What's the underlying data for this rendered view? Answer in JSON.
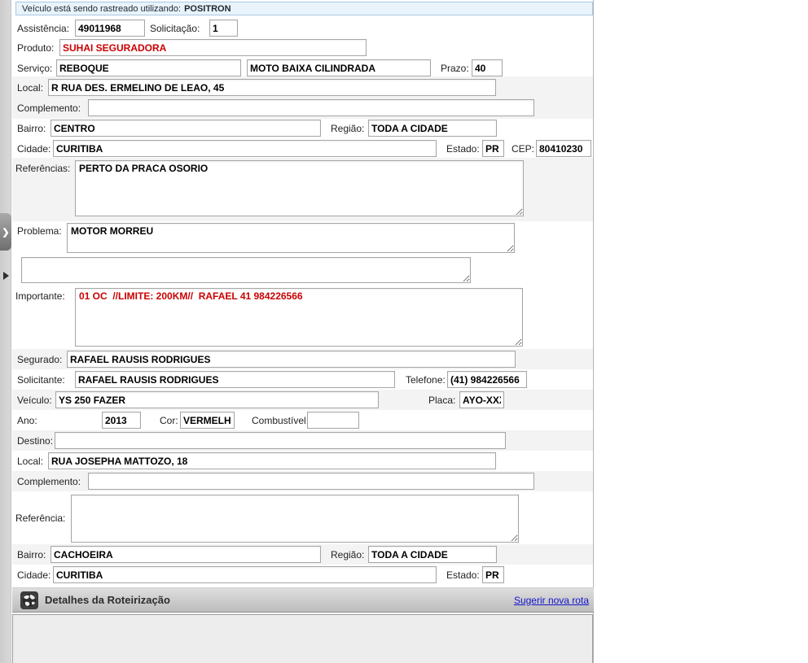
{
  "tracking_bar": {
    "text": "Veículo está sendo rastreado utilizando:",
    "value": "POSITRON"
  },
  "form": {
    "assistencia": {
      "label": "Assistência:",
      "value": "49011968"
    },
    "solicitacao": {
      "label": "Solicitação:",
      "value": "1"
    },
    "produto": {
      "label": "Produto:",
      "value": "SUHAI SEGURADORA"
    },
    "servico": {
      "label": "Serviço:",
      "value": "REBOQUE",
      "value2": "MOTO BAIXA CILINDRADA"
    },
    "prazo": {
      "label": "Prazo:",
      "value": "40"
    },
    "local": {
      "label": "Local:",
      "value": "R RUA DES. ERMELINO DE LEAO, 45"
    },
    "complemento": {
      "label": "Complemento:",
      "value": ""
    },
    "bairro": {
      "label": "Bairro:",
      "value": "CENTRO"
    },
    "regiao": {
      "label": "Região:",
      "value": "TODA A CIDADE"
    },
    "cidade": {
      "label": "Cidade:",
      "value": "CURITIBA"
    },
    "estado": {
      "label": "Estado:",
      "value": "PR"
    },
    "cep": {
      "label": "CEP:",
      "value": "80410230"
    },
    "referencias": {
      "label": "Referências:",
      "value": "PERTO DA PRACA OSORIO"
    },
    "problema": {
      "label": "Problema:",
      "value": "MOTOR MORREU"
    },
    "observacao": {
      "value": ""
    },
    "importante": {
      "label": "Importante:",
      "value": "01 OC  //LIMITE: 200KM//  RAFAEL 41 984226566"
    },
    "segurado": {
      "label": "Segurado:",
      "value": "RAFAEL RAUSIS RODRIGUES"
    },
    "solicitante": {
      "label": "Solicitante:",
      "value": "RAFAEL RAUSIS RODRIGUES"
    },
    "telefone": {
      "label": "Telefone:",
      "value": "(41) 984226566"
    },
    "veiculo": {
      "label": "Veículo:",
      "value": "YS 250 FAZER"
    },
    "placa": {
      "label": "Placa:",
      "value": "AYO-XXXX"
    },
    "ano": {
      "label": "Ano:",
      "value": "2013"
    },
    "cor": {
      "label": "Cor:",
      "value": "VERMELHA"
    },
    "combustivel": {
      "label": "Combustível:",
      "value": ""
    },
    "destino": {
      "label": "Destino:",
      "value": ""
    },
    "local2": {
      "label": "Local:",
      "value": "RUA JOSEPHA MATTOZO, 18"
    },
    "complemento2": {
      "label": "Complemento:",
      "value": ""
    },
    "referencia2": {
      "label": "Referência:",
      "value": ""
    },
    "bairro2": {
      "label": "Bairro:",
      "value": "CACHOEIRA"
    },
    "regiao2": {
      "label": "Região:",
      "value": "TODA A CIDADE"
    },
    "cidade2": {
      "label": "Cidade:",
      "value": "CURITIBA"
    },
    "estado2": {
      "label": "Estado:",
      "value": "PR"
    }
  },
  "routing": {
    "icon": "globe-icon",
    "title": "Detalhes da Roteirização",
    "link_label": "Sugerir nova rota"
  },
  "side_panel": {
    "collapse_icon": "chevron-right-icon",
    "splitter_icon": "triangle-right-icon"
  },
  "colors": {
    "alert_text": "#cc0000",
    "link": "#1414cc",
    "tracking_bar_bg": "#e8f3fb",
    "header_bar_gradient": "#dedede-#bcbcbc"
  }
}
